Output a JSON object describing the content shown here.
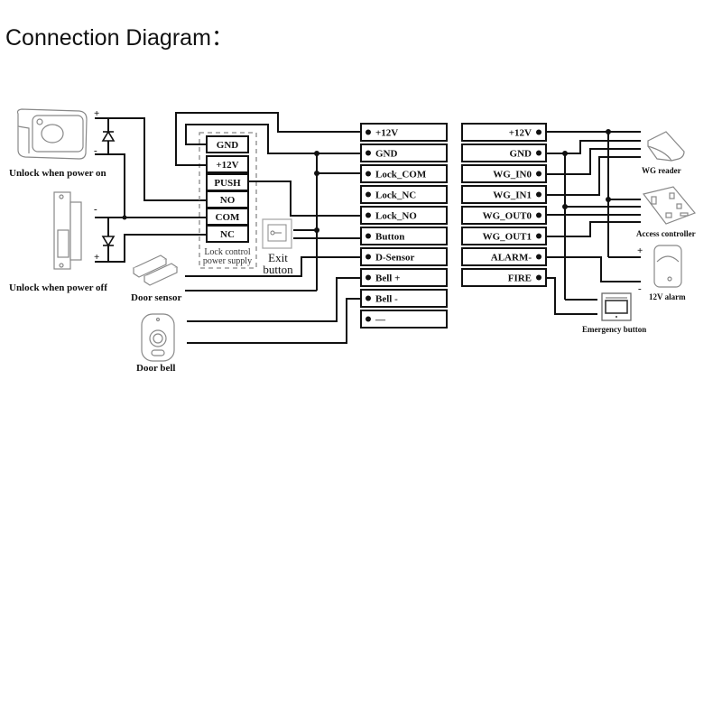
{
  "title": "Connection Diagram：",
  "left_devices": {
    "lock_on": "Unlock when power on",
    "lock_off": "Unlock when power off",
    "door_sensor": "Door sensor",
    "door_bell": "Door bell",
    "plus": "+",
    "minus": "-"
  },
  "power_supply": {
    "terminals": [
      "GND",
      "+12V",
      "PUSH",
      "NO",
      "COM",
      "NC"
    ],
    "caption_line1": "Lock control",
    "caption_line2": "power supply"
  },
  "exit_button": {
    "line1": "Exit",
    "line2": "button"
  },
  "left_terminals": [
    "+12V",
    "GND",
    "Lock_COM",
    "Lock_NC",
    "Lock_NO",
    "Button",
    "D-Sensor",
    "Bell +",
    "Bell -",
    "—"
  ],
  "right_terminals": [
    "+12V",
    "GND",
    "WG_IN0",
    "WG_IN1",
    "WG_OUT0",
    "WG_OUT1",
    "ALARM-",
    "FIRE"
  ],
  "right_devices": {
    "wg_reader": "WG reader",
    "access_controller": "Access controller",
    "alarm": "12V alarm",
    "emergency": "Emergency button",
    "plus": "+",
    "minus": "-"
  }
}
